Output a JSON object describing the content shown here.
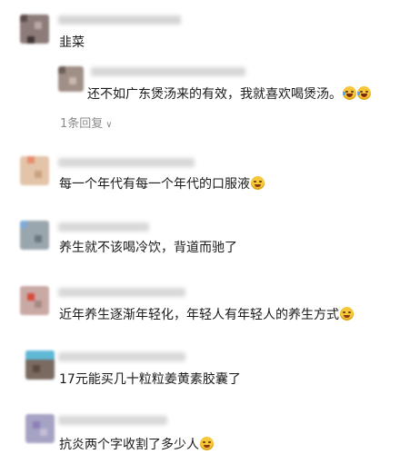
{
  "comments": [
    {
      "text": "韭菜",
      "reply": {
        "text": "还不如广东煲汤来的有效，我就喜欢喝煲汤。",
        "emojis": [
          "laughing-crying-emoji",
          "laughing-crying-emoji"
        ]
      },
      "reply_count": "1条回复"
    },
    {
      "text": "每一个年代有每一个年代的口服液",
      "emoji": "smirk-emoji"
    },
    {
      "text": "养生就不该喝冷饮，背道而驰了"
    },
    {
      "text": "近年养生逐渐年轻化，年轻人有年轻人的养生方式",
      "emoji": "sweat-laugh-emoji"
    },
    {
      "text": "17元能买几十粒粒姜黄素胶囊了"
    },
    {
      "text": "抗炎两个字收割了多少人",
      "emoji": "thinking-emoji"
    }
  ],
  "colors": {
    "text": "#1a1a1a",
    "muted": "#8c8c8c",
    "emoji": "#f5c73a"
  }
}
